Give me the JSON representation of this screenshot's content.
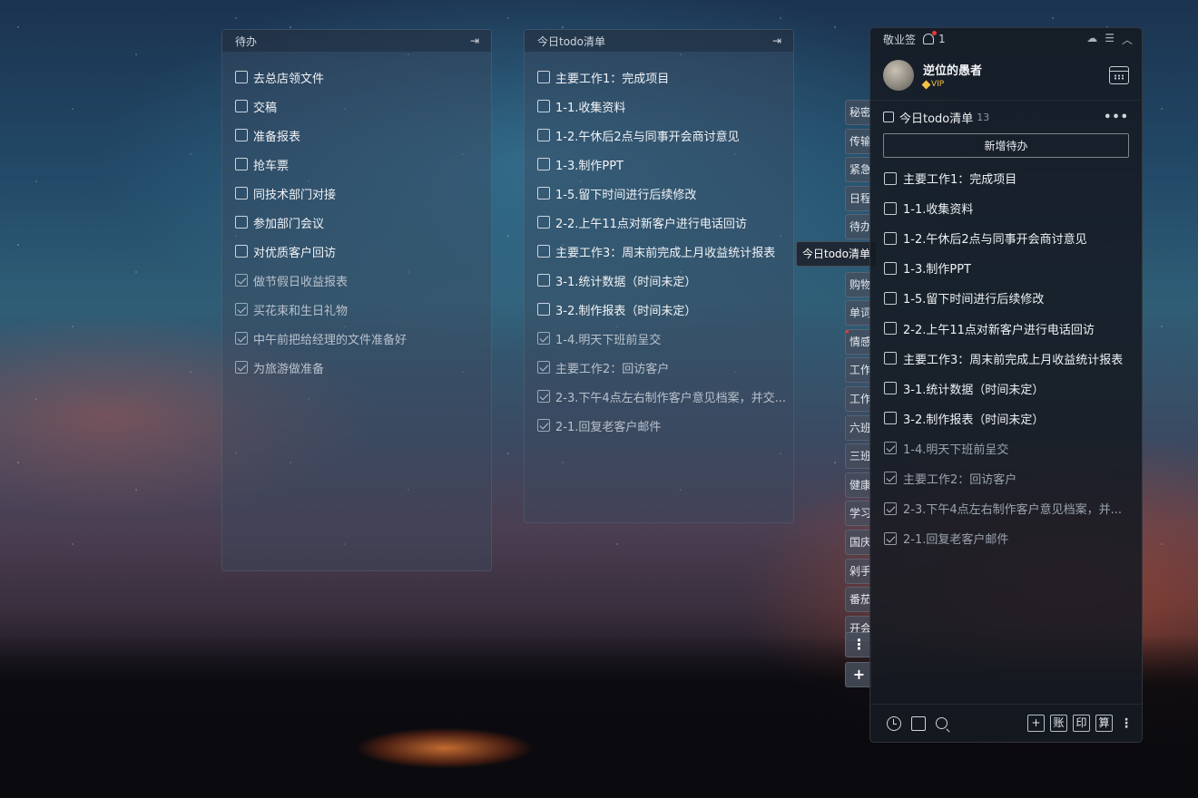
{
  "colors": {
    "accent_red": "#e53935",
    "vip_gold": "#f5c343"
  },
  "note1": {
    "title": "待办",
    "items": [
      {
        "text": "去总店领文件",
        "done": false
      },
      {
        "text": "交稿",
        "done": false
      },
      {
        "text": "准备报表",
        "done": false
      },
      {
        "text": "抢车票",
        "done": false
      },
      {
        "text": "同技术部门对接",
        "done": false
      },
      {
        "text": "参加部门会议",
        "done": false
      },
      {
        "text": "对优质客户回访",
        "done": false
      },
      {
        "text": "做节假日收益报表",
        "done": true
      },
      {
        "text": "买花束和生日礼物",
        "done": true
      },
      {
        "text": "中午前把给经理的文件准备好",
        "done": true
      },
      {
        "text": "为旅游做准备",
        "done": true
      }
    ]
  },
  "note2": {
    "title": "今日todo清单",
    "items": [
      {
        "text": "主要工作1：完成项目",
        "done": false
      },
      {
        "text": "1-1.收集资料",
        "done": false
      },
      {
        "text": "1-2.午休后2点与同事开会商讨意见",
        "done": false
      },
      {
        "text": "1-3.制作PPT",
        "done": false
      },
      {
        "text": "1-5.留下时间进行后续修改",
        "done": false
      },
      {
        "text": "2-2.上午11点对新客户进行电话回访",
        "done": false
      },
      {
        "text": "主要工作3：周末前完成上月收益统计报表",
        "done": false
      },
      {
        "text": "3-1.统计数据（时间未定）",
        "done": false
      },
      {
        "text": "3-2.制作报表（时间未定）",
        "done": false
      },
      {
        "text": "1-4.明天下班前呈交",
        "done": true
      },
      {
        "text": "主要工作2：回访客户",
        "done": true
      },
      {
        "text": "2-3.下午4点左右制作客户意见档案，并交...",
        "done": true
      },
      {
        "text": "2-1.回复老客户邮件",
        "done": true
      }
    ]
  },
  "side_tabs": [
    {
      "label": "秘密",
      "marked": false
    },
    {
      "label": "传输",
      "marked": false
    },
    {
      "label": "紧急",
      "marked": false
    },
    {
      "label": "日程",
      "marked": false
    },
    {
      "label": "待办",
      "marked": false
    },
    {
      "label": "今日todo清单",
      "marked": false,
      "active": true
    },
    {
      "label": "购物",
      "marked": false
    },
    {
      "label": "单词",
      "marked": false
    },
    {
      "label": "情感",
      "marked": true
    },
    {
      "label": "工作",
      "marked": false
    },
    {
      "label": "工作",
      "marked": false
    },
    {
      "label": "六班",
      "marked": false
    },
    {
      "label": "三班",
      "marked": false
    },
    {
      "label": "健康",
      "marked": false
    },
    {
      "label": "学习",
      "marked": false
    },
    {
      "label": "国庆",
      "marked": false
    },
    {
      "label": "剁手",
      "marked": false
    },
    {
      "label": "番茄",
      "marked": false
    },
    {
      "label": "开会",
      "marked": false
    }
  ],
  "tooltip": "今日todo清单",
  "side_more": "⋮",
  "side_add": "+",
  "app": {
    "title": "敬业签",
    "notif_count": "1",
    "user_name": "逆位的愚者",
    "vip_label": "VIP",
    "list_title": "今日todo清单",
    "list_count": "13",
    "more": "•••",
    "add_button": "新增待办",
    "footer_boxes": [
      "+",
      "账",
      "印",
      "算"
    ],
    "footer_more": "⋮",
    "items": [
      {
        "text": "主要工作1：完成项目",
        "done": false
      },
      {
        "text": "1-1.收集资料",
        "done": false
      },
      {
        "text": "1-2.午休后2点与同事开会商讨意见",
        "done": false
      },
      {
        "text": "1-3.制作PPT",
        "done": false
      },
      {
        "text": "1-5.留下时间进行后续修改",
        "done": false
      },
      {
        "text": "2-2.上午11点对新客户进行电话回访",
        "done": false
      },
      {
        "text": "主要工作3：周末前完成上月收益统计报表",
        "done": false
      },
      {
        "text": "3-1.统计数据（时间未定）",
        "done": false
      },
      {
        "text": "3-2.制作报表（时间未定）",
        "done": false
      },
      {
        "text": "1-4.明天下班前呈交",
        "done": true
      },
      {
        "text": "主要工作2：回访客户",
        "done": true
      },
      {
        "text": "2-3.下午4点左右制作客户意见档案，并...",
        "done": true
      },
      {
        "text": "2-1.回复老客户邮件",
        "done": true
      }
    ]
  }
}
